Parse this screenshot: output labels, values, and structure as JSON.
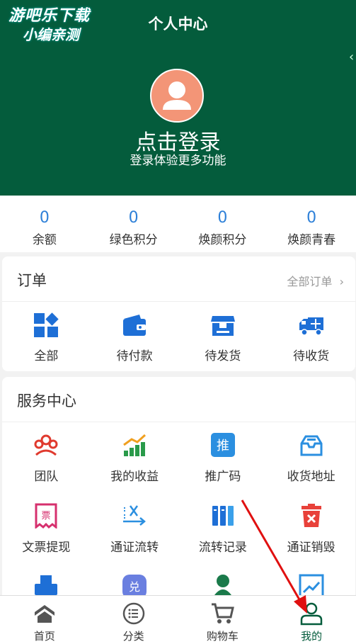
{
  "watermark": {
    "line1": "游吧乐下载",
    "line2": "小编亲测"
  },
  "header": {
    "title": "个人中心",
    "login_title": "点击登录",
    "login_subtitle": "登录体验更多功能"
  },
  "stats": [
    {
      "value": "0",
      "label": "余额"
    },
    {
      "value": "0",
      "label": "绿色积分"
    },
    {
      "value": "0",
      "label": "焕颜积分"
    },
    {
      "value": "0",
      "label": "焕颜青春"
    }
  ],
  "orders": {
    "title": "订单",
    "all_orders": "全部订单",
    "items": [
      {
        "label": "全部",
        "icon": "grid-icon"
      },
      {
        "label": "待付款",
        "icon": "wallet-icon"
      },
      {
        "label": "待发货",
        "icon": "box-icon"
      },
      {
        "label": "待收货",
        "icon": "truck-icon"
      }
    ]
  },
  "services": {
    "title": "服务中心",
    "items": [
      {
        "label": "团队",
        "icon": "team-icon"
      },
      {
        "label": "我的收益",
        "icon": "chart-icon"
      },
      {
        "label": "推广码",
        "icon": "promo-code-icon",
        "glyph": "推"
      },
      {
        "label": "收货地址",
        "icon": "address-icon"
      },
      {
        "label": "文票提现",
        "icon": "ticket-icon",
        "glyph": "票"
      },
      {
        "label": "通证流转",
        "icon": "transfer-icon"
      },
      {
        "label": "流转记录",
        "icon": "records-icon"
      },
      {
        "label": "通证销毁",
        "icon": "delete-icon"
      }
    ],
    "partial_glyph": "兑"
  },
  "tabs": [
    {
      "label": "首页",
      "icon": "home-icon"
    },
    {
      "label": "分类",
      "icon": "category-icon"
    },
    {
      "label": "购物车",
      "icon": "cart-icon"
    },
    {
      "label": "我的",
      "icon": "profile-icon",
      "active": true
    }
  ],
  "colors": {
    "brand_green": "#045C3C",
    "accent_blue": "#2e80d8",
    "avatar_bg": "#F39577",
    "annotation_red": "#e01010"
  }
}
